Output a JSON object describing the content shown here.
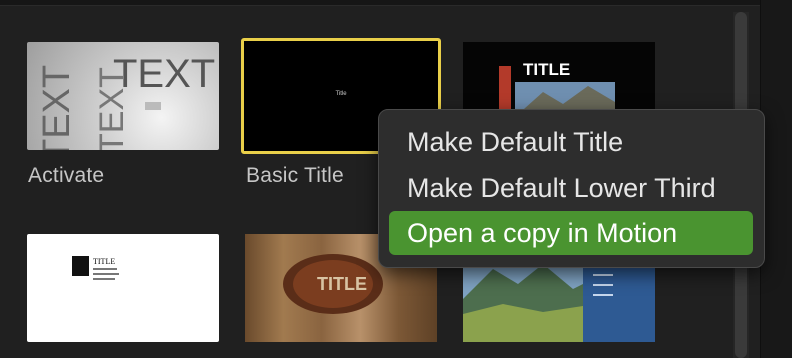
{
  "browser": {
    "tiles": [
      {
        "label": "Activate"
      },
      {
        "label": "Basic Title",
        "preview_text": "Title"
      },
      {
        "label": "",
        "preview_text": "TITLE"
      },
      {
        "label": "",
        "preview_text": "TITLE"
      },
      {
        "label": "",
        "preview_text": "TITLE"
      },
      {
        "label": ""
      }
    ],
    "activate_preview": {
      "big": "TEXT",
      "left_vertical": "TEXT",
      "diag": "TEXT"
    }
  },
  "context_menu": {
    "items": [
      {
        "label": "Make Default Title"
      },
      {
        "label": "Make Default Lower Third"
      },
      {
        "label": "Open a copy in Motion"
      }
    ],
    "highlight_color": "#4a9430"
  },
  "colors": {
    "selection_border": "#e9cf49",
    "background": "#202020"
  }
}
